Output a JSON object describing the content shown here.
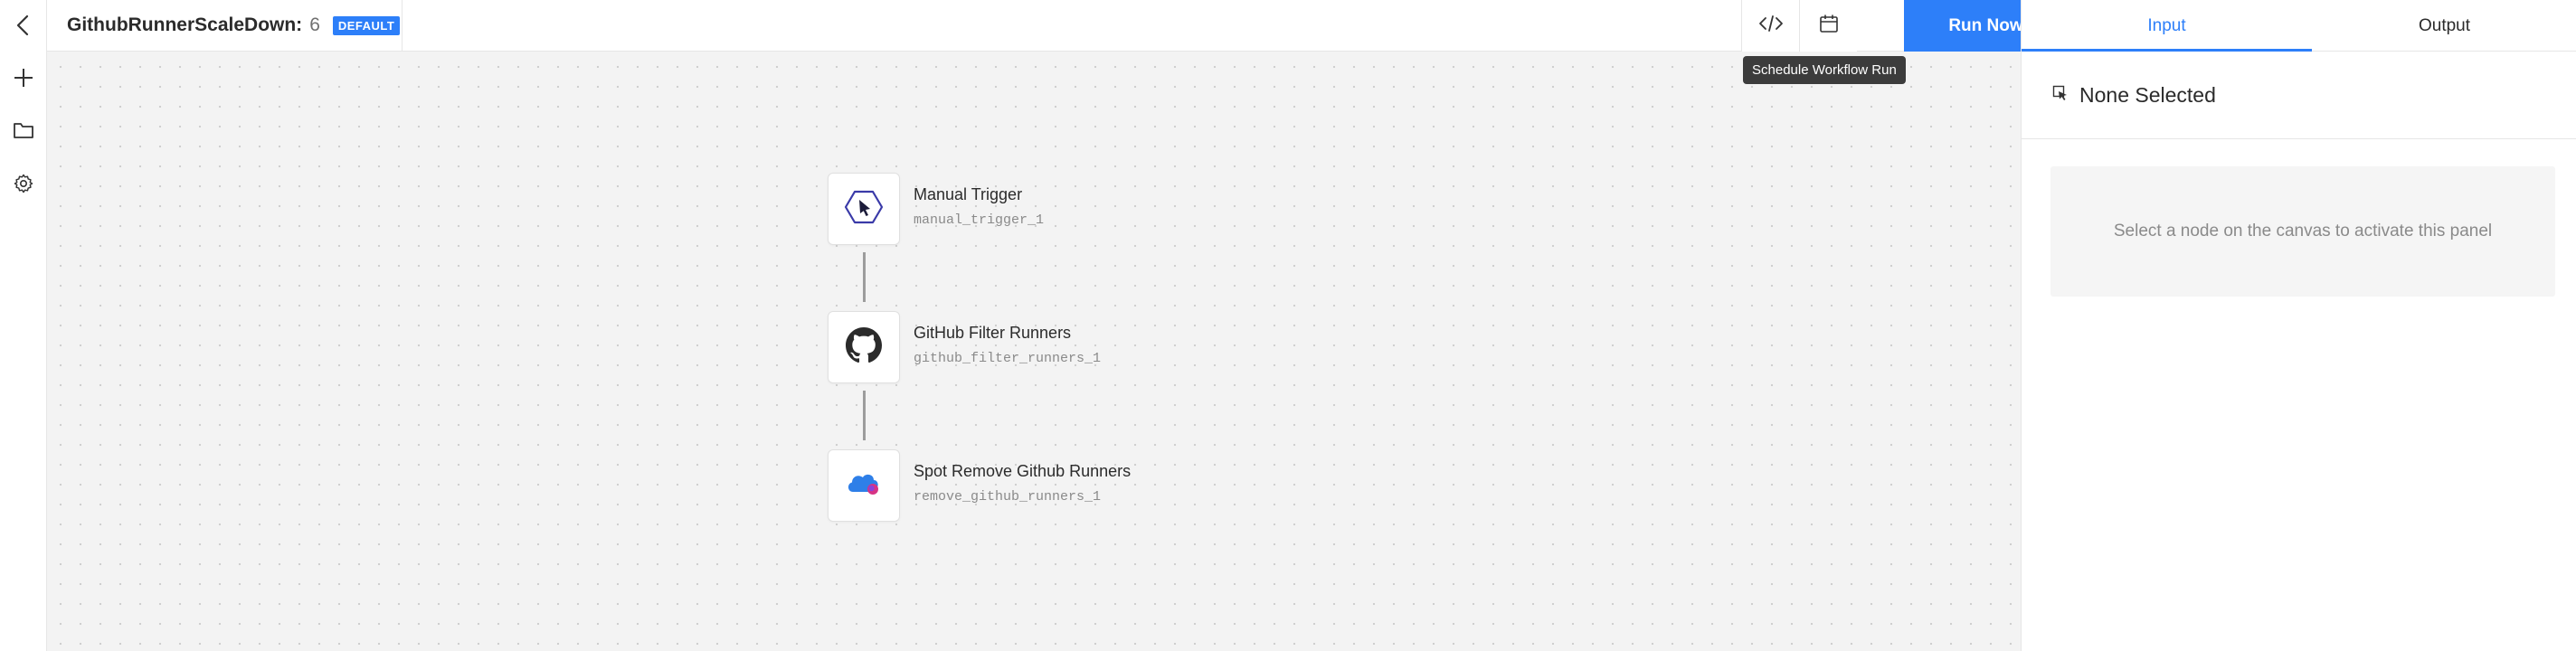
{
  "workflow": {
    "name": "GithubRunnerScaleDown:",
    "version": "6",
    "badge": "DEFAULT"
  },
  "rail": {
    "icons": [
      "back-arrow-icon",
      "plus-icon",
      "folder-icon",
      "gear-icon"
    ]
  },
  "toolbar": {
    "code_icon": "code-icon",
    "schedule_icon": "calendar-icon",
    "run_label": "Run Now",
    "tooltip": "Schedule Workflow Run"
  },
  "nodes": [
    {
      "title": "Manual Trigger",
      "id": "manual_trigger_1",
      "icon": "cursor-hexagon-icon"
    },
    {
      "title": "GitHub Filter Runners",
      "id": "github_filter_runners_1",
      "icon": "github-icon"
    },
    {
      "title": "Spot Remove Github Runners",
      "id": "remove_github_runners_1",
      "icon": "spot-cloud-icon"
    }
  ],
  "panel": {
    "tabs": [
      {
        "label": "Input",
        "active": true
      },
      {
        "label": "Output",
        "active": false
      }
    ],
    "selection_title": "None Selected",
    "hint": "Select a node on the canvas to activate this panel"
  },
  "colors": {
    "accent": "#2d7ff9",
    "canvas": "#f3f3f3",
    "tooltip_bg": "#3c3c3c"
  }
}
